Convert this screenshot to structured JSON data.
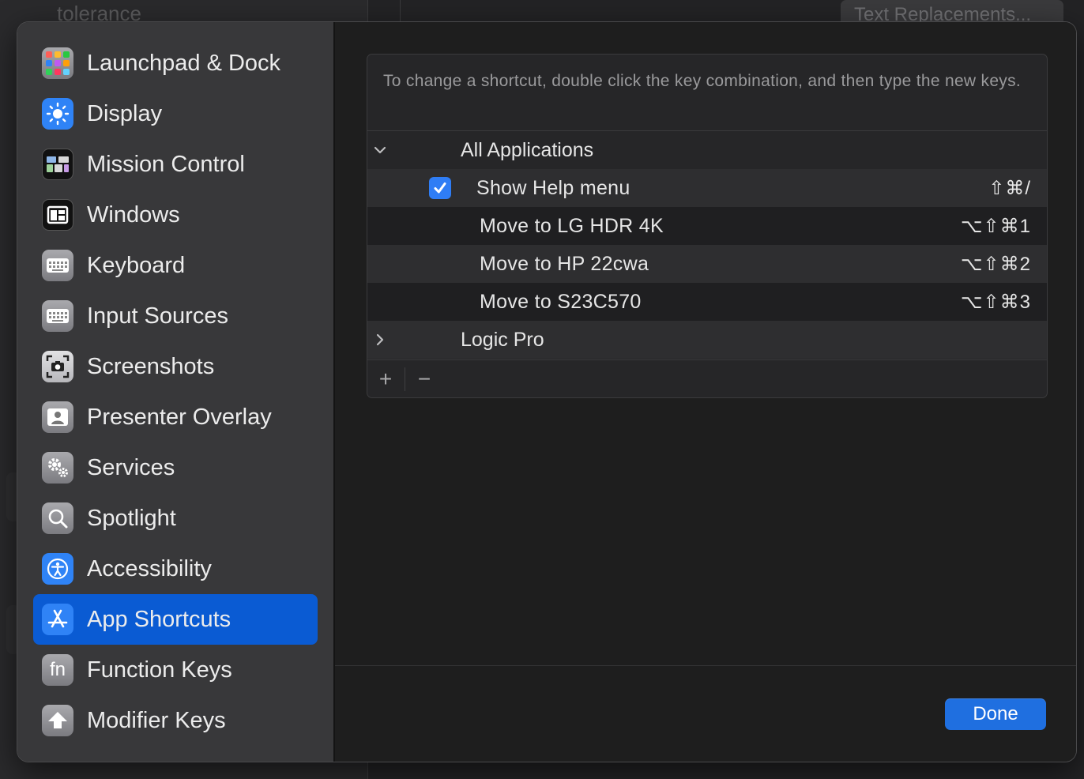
{
  "background": {
    "left_text": "tolerance",
    "button_label": "Text Replacements..."
  },
  "sidebar": {
    "items": [
      {
        "label": "Launchpad & Dock",
        "icon": "launchpad-icon"
      },
      {
        "label": "Display",
        "icon": "sun-icon"
      },
      {
        "label": "Mission Control",
        "icon": "mission-control-icon"
      },
      {
        "label": "Windows",
        "icon": "windows-icon"
      },
      {
        "label": "Keyboard",
        "icon": "keyboard-icon"
      },
      {
        "label": "Input Sources",
        "icon": "keyboard-icon"
      },
      {
        "label": "Screenshots",
        "icon": "camera-icon"
      },
      {
        "label": "Presenter Overlay",
        "icon": "person-icon"
      },
      {
        "label": "Services",
        "icon": "gears-icon"
      },
      {
        "label": "Spotlight",
        "icon": "magnifier-icon"
      },
      {
        "label": "Accessibility",
        "icon": "accessibility-icon"
      },
      {
        "label": "App Shortcuts",
        "icon": "app-store-icon",
        "selected": true
      },
      {
        "label": "Function Keys",
        "icon": "fn-icon"
      },
      {
        "label": "Modifier Keys",
        "icon": "up-arrow-icon"
      }
    ]
  },
  "main": {
    "instructions": "To change a shortcut, double click the key combination, and then type the new keys.",
    "groups": [
      {
        "label": "All Applications",
        "expanded": true,
        "items": [
          {
            "label": "Show Help menu",
            "shortcut": "⇧⌘/",
            "checked": true
          },
          {
            "label": "Move to LG HDR 4K",
            "shortcut": "⌥⇧⌘1"
          },
          {
            "label": "Move to HP 22cwa",
            "shortcut": "⌥⇧⌘2"
          },
          {
            "label": "Move to S23C570",
            "shortcut": "⌥⇧⌘3"
          }
        ]
      },
      {
        "label": "Logic Pro",
        "expanded": false
      }
    ],
    "add_symbol": "+",
    "remove_symbol": "−",
    "done_label": "Done"
  },
  "colors": {
    "accent": "#0a5bd3",
    "button_blue": "#1f6fe0",
    "checkbox": "#2f7df5"
  }
}
